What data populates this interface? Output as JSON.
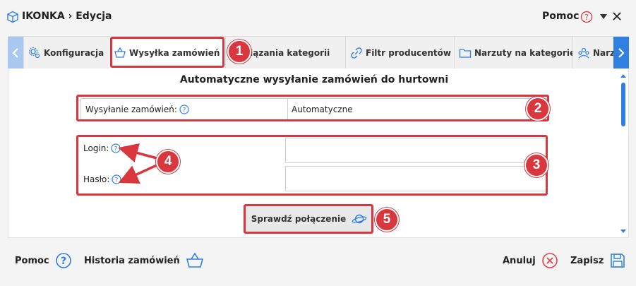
{
  "window": {
    "title": "IKONKA › Edycja",
    "help_label": "Pomoc"
  },
  "tabs": [
    {
      "label": "Konfiguracja",
      "icon": "gear-cluster-icon"
    },
    {
      "label": "Wysyłka zamówień",
      "icon": "basket-icon",
      "active": true
    },
    {
      "label": "Powiązania kategorii",
      "icon": "link-icon"
    },
    {
      "label": "Filtr producentów",
      "icon": "filter-icon"
    },
    {
      "label": "Narzuty na kategorie",
      "icon": "folder-icon"
    },
    {
      "label": "Narzuty",
      "icon": "people-icon"
    }
  ],
  "section": {
    "title": "Automatyczne wysyłanie zamówień do hurtowni"
  },
  "form": {
    "sending_label": "Wysyłanie zamówień:",
    "sending_value": "Automatyczne",
    "login_label": "Login:",
    "login_value": "",
    "password_label": "Hasło:",
    "password_value": "",
    "check_button": "Sprawdź połączenie"
  },
  "annotations": [
    "1",
    "2",
    "3",
    "4",
    "5"
  ],
  "footer": {
    "help": "Pomoc",
    "history": "Historia zamówień",
    "cancel": "Anuluj",
    "save": "Zapisz"
  },
  "colors": {
    "accent": "#2f80e0",
    "highlight": "#d9363e",
    "cancel": "#e0434b"
  }
}
